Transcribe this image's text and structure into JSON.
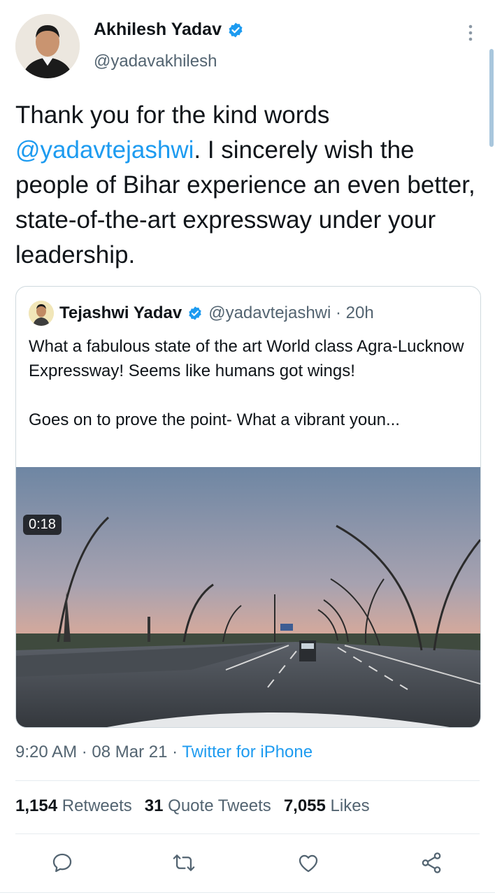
{
  "author": {
    "name": "Akhilesh Yadav",
    "handle": "@yadavakhilesh",
    "verified_icon": "verified-badge-icon"
  },
  "tweet": {
    "text_before": "Thank you for the kind words ",
    "mention": "@yadavtejashwi",
    "text_after": ". I sincerely wish the people of Bihar experience an even better, state-of-the-art expressway under your leadership."
  },
  "quote": {
    "name": "Tejashwi Yadav",
    "handle_time": "@yadavtejashwi · 20h",
    "para1": "What a fabulous state of the art World class Agra-Lucknow Expressway! Seems like humans got wings!",
    "para2": "Goes on to prove the point- What a vibrant youn...",
    "video_duration": "0:18"
  },
  "meta": {
    "time_date": "9:20 AM · 08 Mar 21 · ",
    "source": "Twitter for iPhone"
  },
  "stats": {
    "retweets_count": "1,154",
    "retweets_label": "Retweets",
    "quotes_count": "31",
    "quotes_label": "Quote Tweets",
    "likes_count": "7,055",
    "likes_label": "Likes"
  },
  "colors": {
    "accent": "#1d9bf0",
    "secondary_text": "#536471",
    "divider": "#e6ecf0"
  },
  "actions": [
    "reply-icon",
    "retweet-icon",
    "like-icon",
    "share-icon"
  ]
}
